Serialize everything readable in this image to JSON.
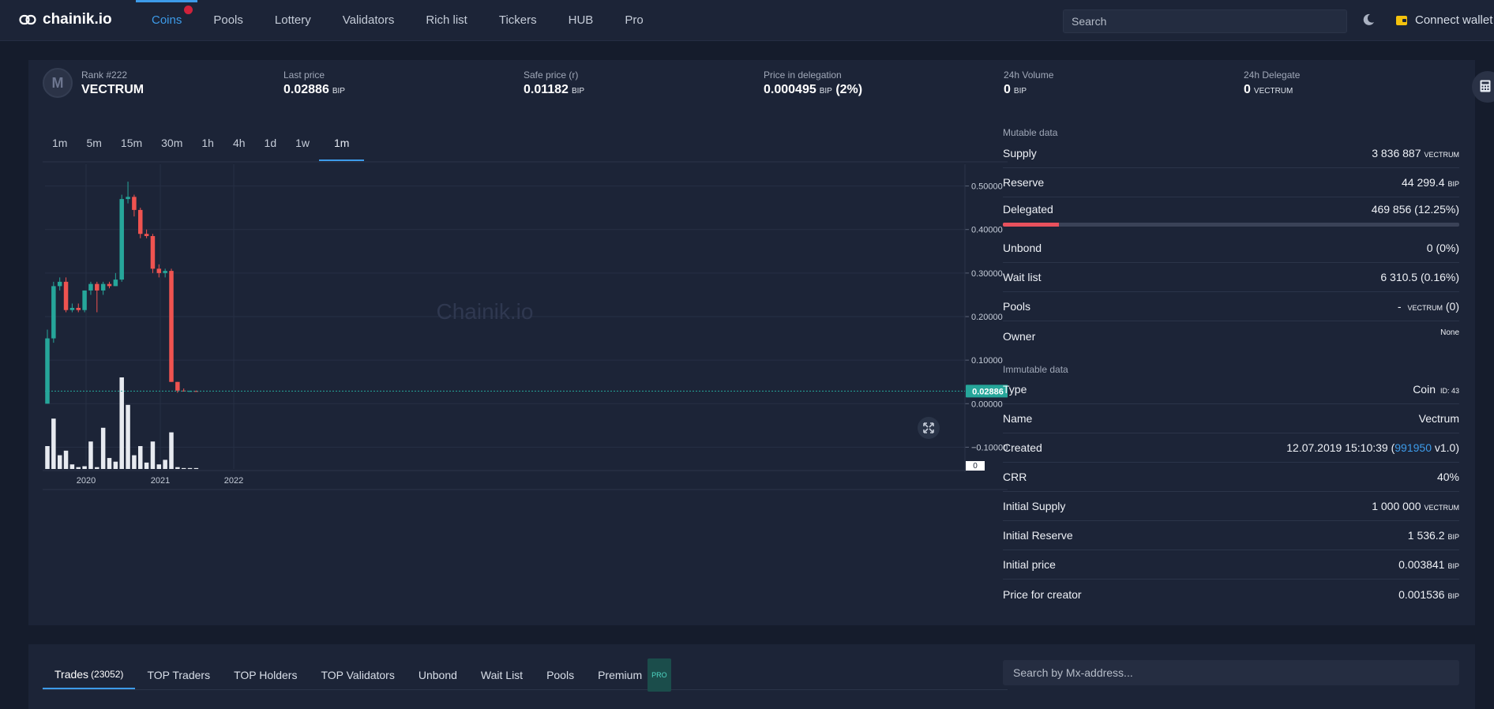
{
  "app": {
    "logo_text": "chainik.io"
  },
  "nav": {
    "items": [
      "Coins",
      "Pools",
      "Lottery",
      "Validators",
      "Rich list",
      "Tickers",
      "HUB",
      "Pro"
    ],
    "active": "Coins"
  },
  "search": {
    "placeholder": "Search"
  },
  "wallet": {
    "label": "Connect wallet"
  },
  "stats": {
    "rank_label": "Rank #222",
    "coin_name": "VECTRUM",
    "last_price": {
      "label": "Last price",
      "value": "0.02886",
      "unit": "BIP"
    },
    "safe_price": {
      "label": "Safe price (r)",
      "value": "0.01182",
      "unit": "BIP"
    },
    "delegation_price": {
      "label": "Price in delegation",
      "value": "0.000495",
      "unit": "BIP",
      "extra": "(2%)"
    },
    "volume": {
      "label": "24h Volume",
      "value": "0",
      "unit": "BIP"
    },
    "delegate": {
      "label": "24h Delegate",
      "value": "0",
      "unit": "VECTRUM"
    }
  },
  "timeframes": [
    "1m",
    "5m",
    "15m",
    "30m",
    "1h",
    "4h",
    "1d",
    "1w",
    "1m"
  ],
  "timeframe_active_index": 8,
  "chart_data": {
    "type": "candlestick",
    "watermark": "Chainik.io",
    "y_ticks": [
      "0.50000",
      "0.40000",
      "0.30000",
      "0.20000",
      "0.10000",
      "0.00000",
      "−0.10000"
    ],
    "y_range": [
      -0.15,
      0.55
    ],
    "x_ticks": [
      "2020",
      "2021",
      "2022"
    ],
    "last_price_label": "0.02886",
    "last_price": 0.02886,
    "volume_axis_label": "0",
    "colors": {
      "up": "#26a69a",
      "down": "#ef5350",
      "volume": "#e7eaf0",
      "price_line": "#26a69a"
    },
    "candles": [
      {
        "o": 0.0,
        "h": 0.17,
        "l": 0.0,
        "c": 0.15
      },
      {
        "o": 0.15,
        "h": 0.28,
        "l": 0.14,
        "c": 0.27
      },
      {
        "o": 0.27,
        "h": 0.29,
        "l": 0.26,
        "c": 0.28
      },
      {
        "o": 0.28,
        "h": 0.29,
        "l": 0.21,
        "c": 0.215
      },
      {
        "o": 0.215,
        "h": 0.23,
        "l": 0.21,
        "c": 0.22
      },
      {
        "o": 0.22,
        "h": 0.23,
        "l": 0.21,
        "c": 0.215
      },
      {
        "o": 0.215,
        "h": 0.26,
        "l": 0.21,
        "c": 0.26
      },
      {
        "o": 0.26,
        "h": 0.28,
        "l": 0.25,
        "c": 0.275
      },
      {
        "o": 0.275,
        "h": 0.28,
        "l": 0.21,
        "c": 0.26
      },
      {
        "o": 0.26,
        "h": 0.28,
        "l": 0.25,
        "c": 0.275
      },
      {
        "o": 0.275,
        "h": 0.28,
        "l": 0.265,
        "c": 0.27
      },
      {
        "o": 0.27,
        "h": 0.3,
        "l": 0.27,
        "c": 0.285
      },
      {
        "o": 0.285,
        "h": 0.48,
        "l": 0.28,
        "c": 0.47
      },
      {
        "o": 0.47,
        "h": 0.51,
        "l": 0.46,
        "c": 0.475
      },
      {
        "o": 0.475,
        "h": 0.48,
        "l": 0.43,
        "c": 0.445
      },
      {
        "o": 0.445,
        "h": 0.45,
        "l": 0.38,
        "c": 0.39
      },
      {
        "o": 0.39,
        "h": 0.4,
        "l": 0.38,
        "c": 0.385
      },
      {
        "o": 0.385,
        "h": 0.39,
        "l": 0.3,
        "c": 0.31
      },
      {
        "o": 0.31,
        "h": 0.32,
        "l": 0.29,
        "c": 0.3
      },
      {
        "o": 0.3,
        "h": 0.31,
        "l": 0.29,
        "c": 0.305
      },
      {
        "o": 0.305,
        "h": 0.31,
        "l": 0.05,
        "c": 0.05
      },
      {
        "o": 0.05,
        "h": 0.05,
        "l": 0.025,
        "c": 0.03
      },
      {
        "o": 0.03,
        "h": 0.035,
        "l": 0.028,
        "c": 0.029
      },
      {
        "o": 0.029,
        "h": 0.03,
        "l": 0.028,
        "c": 0.029
      },
      {
        "o": 0.029,
        "h": 0.03,
        "l": 0.028,
        "c": 0.02886
      }
    ],
    "volumes": [
      0.25,
      0.55,
      0.15,
      0.2,
      0.05,
      0.02,
      0.03,
      0.3,
      0.02,
      0.45,
      0.12,
      0.08,
      1.0,
      0.7,
      0.15,
      0.25,
      0.07,
      0.3,
      0.05,
      0.1,
      0.4,
      0.02,
      0.01,
      0.01,
      0.01
    ]
  },
  "mutable": {
    "label": "Mutable data",
    "supply": {
      "label": "Supply",
      "value": "3 836 887",
      "unit": "VECTRUM"
    },
    "reserve": {
      "label": "Reserve",
      "value": "44 299.4",
      "unit": "BIP"
    },
    "delegated": {
      "label": "Delegated",
      "value": "469 856 (12.25%)",
      "percent": 12.25
    },
    "unbond": {
      "label": "Unbond",
      "value": "0 (0%)"
    },
    "wait_list": {
      "label": "Wait list",
      "value": "6 310.5 (0.16%)"
    },
    "pools": {
      "label": "Pools",
      "value": "-",
      "unit": "VECTRUM",
      "extra": "(0)"
    },
    "owner": {
      "label": "Owner",
      "value": "None"
    }
  },
  "immutable": {
    "label": "Immutable data",
    "type": {
      "label": "Type",
      "value": "Coin",
      "id": "ID: 43"
    },
    "name": {
      "label": "Name",
      "value": "Vectrum"
    },
    "created": {
      "label": "Created",
      "date": "12.07.2019 15:10:39 (",
      "block": "991950",
      "version": " v1.0)"
    },
    "crr": {
      "label": "CRR",
      "value": "40%"
    },
    "initial_supply": {
      "label": "Initial Supply",
      "value": "1 000 000",
      "unit": "VECTRUM"
    },
    "initial_reserve": {
      "label": "Initial Reserve",
      "value": "1 536.2",
      "unit": "BIP"
    },
    "initial_price": {
      "label": "Initial price",
      "value": "0.003841",
      "unit": "BIP"
    },
    "creator_price": {
      "label": "Price for creator",
      "value": "0.001536",
      "unit": "BIP"
    }
  },
  "bottom_tabs": {
    "trades": {
      "label": "Trades",
      "count": "(23052)"
    },
    "top_traders": "TOP Traders",
    "top_holders": "TOP Holders",
    "top_validators": "TOP Validators",
    "unbond": "Unbond",
    "wait_list": "Wait List",
    "pools": "Pools",
    "premium": {
      "label": "Premium",
      "badge": "PRO"
    }
  },
  "address_search": {
    "placeholder": "Search by Mx-address..."
  }
}
